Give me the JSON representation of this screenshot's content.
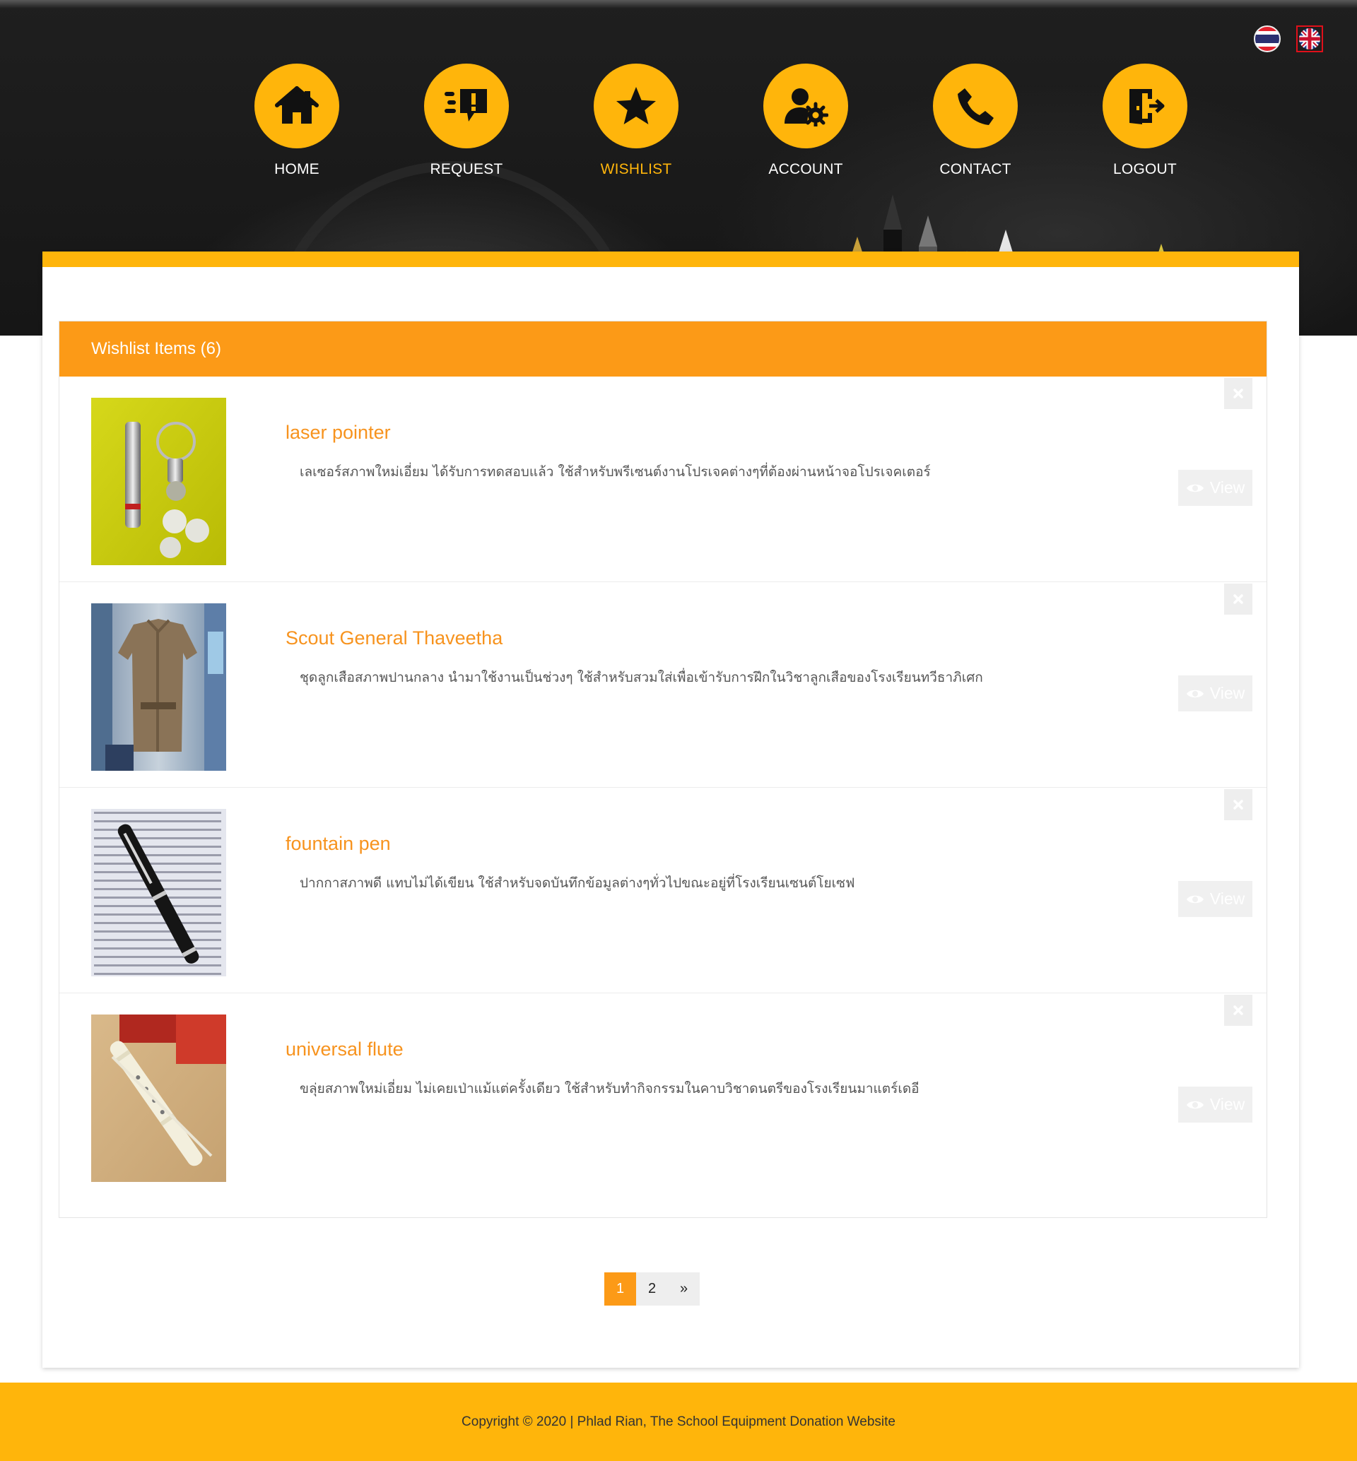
{
  "nav": {
    "items": [
      {
        "label": "HOME",
        "icon": "home-icon"
      },
      {
        "label": "REQUEST",
        "icon": "request-icon"
      },
      {
        "label": "WISHLIST",
        "icon": "star-icon"
      },
      {
        "label": "ACCOUNT",
        "icon": "account-settings-icon"
      },
      {
        "label": "CONTACT",
        "icon": "phone-icon"
      },
      {
        "label": "LOGOUT",
        "icon": "logout-icon"
      }
    ],
    "active": "WISHLIST"
  },
  "languages": [
    "thai-flag-icon",
    "uk-flag-icon"
  ],
  "wishlist": {
    "title": "Wishlist Items (6)",
    "view_label": "View",
    "items": [
      {
        "title": "laser pointer",
        "description": "เลเซอร์สภาพใหม่เอี่ยม ได้รับการทดสอบแล้ว ใช้สำหรับพรีเซนต์งานโปรเจคต่างๆที่ต้องผ่านหน้าจอโปรเจคเตอร์"
      },
      {
        "title": "Scout General Thaveetha",
        "description": "ชุดลูกเสือสภาพปานกลาง นำมาใช้งานเป็นช่วงๆ ใช้สำหรับสวมใส่เพื่อเข้ารับการฝึกในวิชาลูกเสือของโรงเรียนทวีธาภิเศก"
      },
      {
        "title": "fountain pen",
        "description": "ปากกาสภาพดี แทบไม่ได้เขียน ใช้สำหรับจดบันทึกข้อมูลต่างๆทั่วไปขณะอยู่ที่โรงเรียนเซนต์โยเซฟ"
      },
      {
        "title": "universal flute",
        "description": "ขลุ่ยสภาพใหม่เอี่ยม ไม่เคยเป่าแม้แต่ครั้งเดียว ใช้สำหรับทำกิจกรรมในคาบวิชาดนตรีของโรงเรียนมาแตร์เดอี"
      }
    ]
  },
  "pagination": {
    "pages": [
      "1",
      "2"
    ],
    "next": "»",
    "current": "1"
  },
  "footer": {
    "text": "Copyright © 2020 | Phlad Rian, The School Equipment Donation Website"
  },
  "colors": {
    "accent": "#ffb50b",
    "panel_header": "#fc9a17",
    "title": "#f7931e"
  }
}
